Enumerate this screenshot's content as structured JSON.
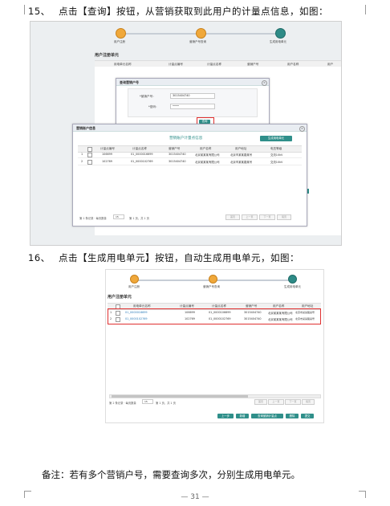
{
  "step15": {
    "num": "15、",
    "text": "点击【查询】按钮，从营销获取到此用户的计量点信息，如图："
  },
  "step16": {
    "num": "16、",
    "text": "点击【生成用电单元】按钮，自动生成用电单元，如图："
  },
  "note": "备注：若有多个营销户号，需要查询多次，分别生成用电单元。",
  "page_number": "— 31 —",
  "shot1": {
    "steps": [
      "用户注册",
      "营销户号查询",
      "生成用电单元"
    ],
    "section_title": "用户注册单元",
    "columns": [
      "用电单元名称",
      "计量点编号",
      "计量点名称",
      "营销户号",
      "用户名称",
      "用户"
    ],
    "query_dialog": {
      "title": "查询营销户号",
      "label_account": "*营销户号：",
      "value_account": "3015404740",
      "label_password": "*密码：",
      "value_password": "••••",
      "query_button": "查询"
    },
    "info_dialog": {
      "title": "营销账户信息",
      "subtitle": "营销账户计量点信息",
      "generate_button": "生成用电单元",
      "columns": [
        "计量点编号",
        "计量点名称",
        "营销户号",
        "用户名称",
        "用户地址",
        "电压等级"
      ],
      "rows": [
        [
          "1",
          "106699",
          "01_0000016699",
          "3015404740",
          "北京某某某有限公司",
          "北京市某某路某号",
          "交流10kV"
        ],
        [
          "2",
          "102769",
          "01_0000102769",
          "3015404740",
          "北京某某某有限公司",
          "北京市某某路某号",
          "交流10kV"
        ]
      ],
      "pager_left": "第 1 条记录 · 每页数量",
      "pager_page": "第 1 页，共 1 页",
      "pager_buttons": [
        "首页",
        "上一页",
        "下一页",
        "尾页"
      ]
    }
  },
  "shot2": {
    "steps": [
      "用户注册",
      "营销户号查询",
      "生成用电单元"
    ],
    "section_title": "用户注册单元",
    "columns": [
      "用电单元名称",
      "计量点编号",
      "计量点名称",
      "营销户号",
      "用户名称",
      "用户地址"
    ],
    "rows": [
      [
        "1",
        "01_0000016699",
        "106699",
        "01_0000106699",
        "3015404740",
        "北京某某某有限公司",
        "北京市某某路某号"
      ],
      [
        "2",
        "01_0000102769",
        "102769",
        "01_0000102769",
        "3015404740",
        "北京某某某有限公司",
        "北京市某某路某号"
      ]
    ],
    "pager_left": "第 2 条记录 · 每页数量",
    "pager_page": "第 1 页，共 1 页",
    "pager_buttons": [
      "首页",
      "上一页",
      "下一页",
      "尾页"
    ],
    "action_buttons": [
      "上一步",
      "新增",
      "查询营销计量点",
      "删除",
      "提交"
    ]
  },
  "colors": {
    "accent": "#2f8f8a",
    "step_orange": "#f0a83a",
    "highlight": "#e03030"
  }
}
